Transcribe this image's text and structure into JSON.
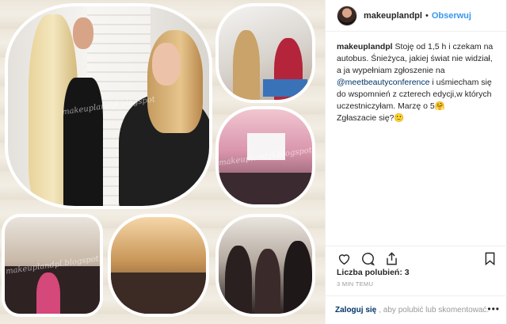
{
  "post": {
    "username": "makeuplandpl",
    "follow_label": "Obserwuj",
    "separator": "•"
  },
  "caption": {
    "username": "makeuplandpl",
    "text_before": "Stoję od 1,5 h i czekam na autobus. Śnieżyca, jakiej świat nie widział, a ja wypełniam zgłoszenie na ",
    "mention": "@meetbeautyconference",
    "text_after": " i uśmiecham się do wspomnień z czterech edycji,w których uczestniczyłam. Marzę o 5🤗",
    "line2": "Zgłaszacie się?🙂"
  },
  "likes": {
    "label": "Liczba polubień: 3"
  },
  "timestamp": "3 MIN TEMU",
  "footer": {
    "login_label": "Zaloguj się",
    "text": ", aby polubić lub skomentować.",
    "more": "•••"
  },
  "watermarks": [
    "makeuplandpl.blogspot",
    "makeuplandpl.blogspot",
    "makeuplandpl.blogspot"
  ],
  "icons": {
    "like": "heart-icon",
    "comment": "comment-icon",
    "share": "share-icon",
    "save": "bookmark-icon"
  },
  "colors": {
    "accent": "#3897f0",
    "text": "#262626",
    "muted": "#999999",
    "link": "#003569"
  }
}
